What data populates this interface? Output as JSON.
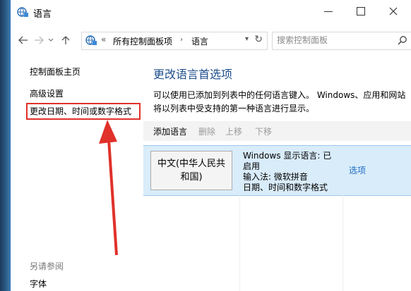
{
  "window": {
    "title": "语言"
  },
  "address": {
    "separator": "«",
    "crumb1": "所有控制面板项",
    "crumb2": "语言",
    "search_placeholder": "搜索控制面板"
  },
  "leftnav": {
    "home": "控制面板主页",
    "advanced": "高级设置",
    "date_format": "更改日期、时间或数字格式",
    "see_also": "另请参阅",
    "fonts": "字体"
  },
  "main": {
    "title": "更改语言首选项",
    "description": "可以使用已添加到列表中的任何语言键入。 Windows、应用和网站将以列表中受支持的第一种语言进行显示。",
    "toolbar": {
      "add": "添加语言",
      "remove": "删除",
      "move_up": "上移",
      "move_down": "下移"
    },
    "language": {
      "name": "中文(中华人民共和国)",
      "info_line1": "Windows 显示语言: 已启用",
      "info_line2": "输入法: 微软拼音",
      "info_line3": "日期、时间和数字格式",
      "options": "选项"
    }
  },
  "colors": {
    "highlight_box": "#e0312a",
    "arrow": "#e0312a",
    "title_blue": "#1e4e8c",
    "link_blue": "#1e6bc0",
    "selected_row": "#d9ecfa"
  }
}
